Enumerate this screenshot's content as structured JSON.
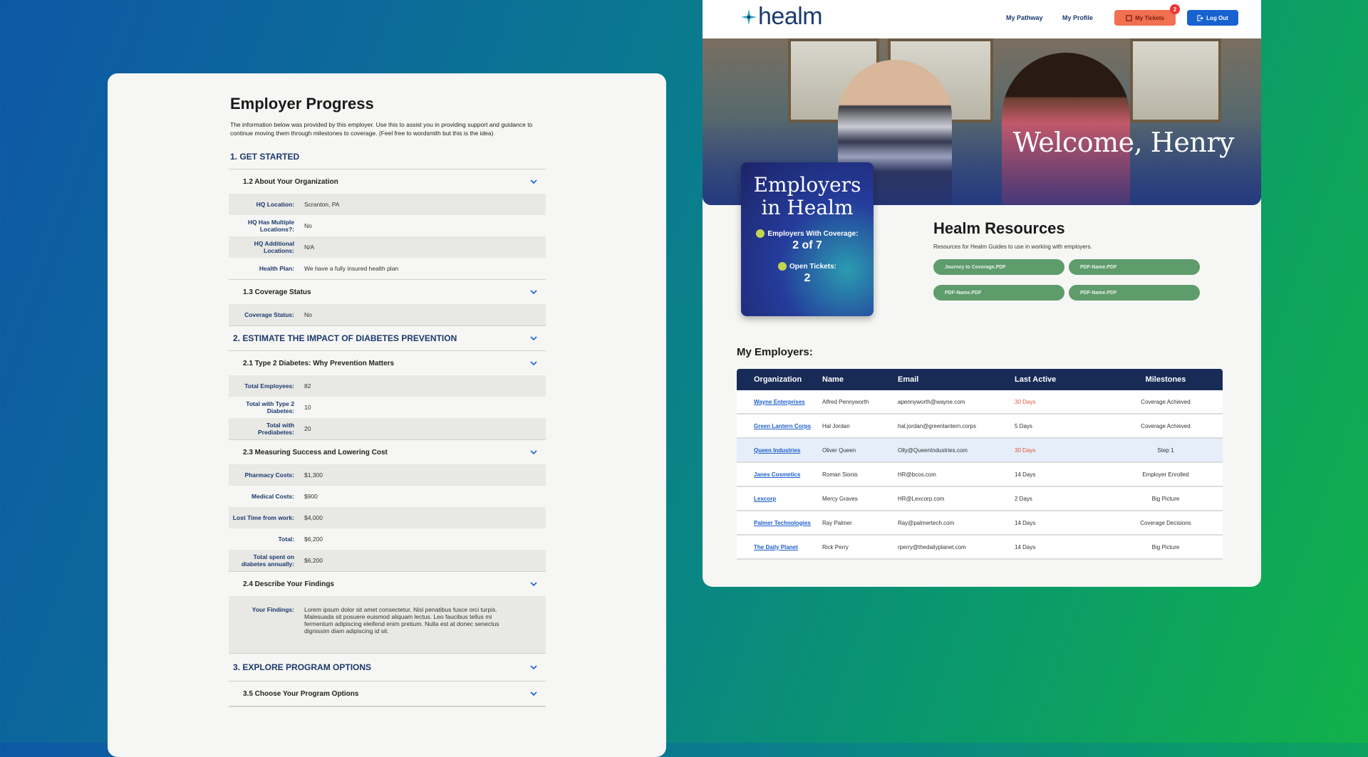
{
  "employer_progress": {
    "title": "Employer Progress",
    "description": "The information below was provided by this employer. Use this to assist you in providing support and guidance to continue moving them through milestones to coverage. (Feel free to wordsmith but this is the idea)",
    "section1": "1. GET STARTED",
    "s12": "1.2 About Your Organization",
    "hq_location_k": "HQ Location:",
    "hq_location_v": "Scranton, PA",
    "hq_multi_k": "HQ Has Multiple Locations?:",
    "hq_multi_v": "No",
    "hq_add_k": "HQ Additional Locations:",
    "hq_add_v": "N/A",
    "health_plan_k": "Health Plan:",
    "health_plan_v": "We have a fully insured health plan",
    "s13": "1.3 Coverage Status",
    "coverage_k": "Coverage Status:",
    "coverage_v": "No",
    "section2": "2. ESTIMATE THE IMPACT OF DIABETES PREVENTION",
    "s21": "2.1 Type 2 Diabetes: Why Prevention Matters",
    "total_emp_k": "Total Employees:",
    "total_emp_v": "82",
    "total_t2_k": "Total with Type 2 Diabetes:",
    "total_t2_v": "10",
    "total_pre_k": "Total with Prediabetes:",
    "total_pre_v": "20",
    "s23": "2.3 Measuring Success and Lowering Cost",
    "pharm_k": "Pharmacy Costs:",
    "pharm_v": "$1,300",
    "med_k": "Medical Costs:",
    "med_v": "$900",
    "lost_k": "Lost Time from work:",
    "lost_v": "$4,000",
    "total_k": "Total:",
    "total_v": "$6,200",
    "annual_k": "Total spent on diabetes annually:",
    "annual_v": "$6,200",
    "s24": "2.4 Describe Your Findings",
    "findings_k": "Your Findings:",
    "findings_v": "Lorem ipsum dolor sit amet consectetur. Nisl penatibus fusce orci turpis. Malesuada sit posuere euismod aliquam lectus. Leo faucibus tellus mi fermentum adipiscing eleifend enim pretium. Nulla est at donec senectus dignissim diam adipiscing id sit.",
    "section3": "3. EXPLORE PROGRAM OPTIONS",
    "s35": "3.5 Choose Your Program Options"
  },
  "nav": {
    "logo": "healm",
    "pathway": "My Pathway",
    "profile": "My Profile",
    "tickets": "My Tickets",
    "tickets_badge": "2",
    "logout": "Log Out"
  },
  "hero": {
    "welcome": "Welcome, Henry"
  },
  "stats": {
    "title": "Employers in Healm",
    "coverage_label": "Employers With Coverage:",
    "coverage_value": "2 of 7",
    "tickets_label": "Open Tickets:",
    "tickets_value": "2"
  },
  "resources": {
    "title": "Healm Resources",
    "desc": "Resources for Healm Guides to use in working with employers.",
    "buttons": [
      "Journey to Coverage.PDF",
      "PDF-Name.PDF",
      "PDF-Name.PDF",
      "PDF-Name.PDF"
    ]
  },
  "employers": {
    "heading": "My Employers:",
    "columns": [
      "Organization",
      "Name",
      "Email",
      "Last Active",
      "Milestones"
    ],
    "rows": [
      [
        "Wayne Enterprises",
        "Alfred Pennyworth",
        "apennyworth@wayne.com",
        "30 Days",
        "Coverage Achieved"
      ],
      [
        "Green Lantern Corps",
        "Hal Jordan",
        "hal.jordan@greenlantern.corps",
        "5 Days",
        "Coverage Achieved"
      ],
      [
        "Queen Industries",
        "Oliver Queen",
        "Olly@QueenIndustries.com",
        "30 Days",
        "Step 1"
      ],
      [
        "Janes Cosmetics",
        "Roman Sionis",
        "HR@bcos.com",
        "14 Days",
        "Employer Enrolled"
      ],
      [
        "Lexcorp",
        "Mercy Graves",
        "HR@Lexcorp.com",
        "2 Days",
        "Big Picture"
      ],
      [
        "Palmer Technologies",
        "Ray Palmer",
        "Ray@palmertech.com",
        "14 Days",
        "Coverage Decisions"
      ],
      [
        "The Daily Planet",
        "Rick Perry",
        "rperry@thedailyplanet.com",
        "14 Days",
        "Big Picture"
      ]
    ]
  },
  "colors": {
    "navy": "#1b3a6d",
    "accent_red": "#e2563c",
    "green_btn": "#5e9c6b",
    "blue_btn": "#1762d0"
  }
}
